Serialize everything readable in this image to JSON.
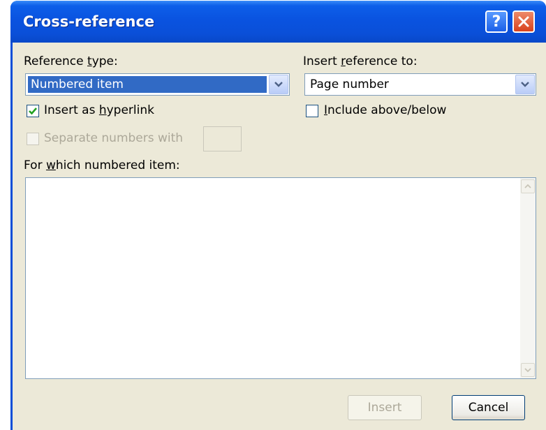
{
  "window": {
    "title": "Cross-reference",
    "help_glyph": "?"
  },
  "reference_type": {
    "label_pre": "Reference ",
    "label_access": "t",
    "label_post": "ype:",
    "value": "Numbered item"
  },
  "insert_reference_to": {
    "label_pre": "Insert ",
    "label_access": "r",
    "label_post": "eference to:",
    "value": "Page number"
  },
  "insert_as_hyperlink": {
    "label_pre": "Insert as ",
    "label_access": "h",
    "label_post": "yperlink",
    "checked": true
  },
  "include_above_below": {
    "label_pre": "",
    "label_access": "I",
    "label_post": "nclude above/below",
    "checked": false
  },
  "separate_numbers": {
    "label": "Separate numbers with",
    "checked": false,
    "enabled": false,
    "value": ""
  },
  "for_which": {
    "label_pre": "For ",
    "label_access": "w",
    "label_post": "hich numbered item:",
    "items": []
  },
  "buttons": {
    "insert": "Insert",
    "cancel": "Cancel"
  },
  "colors": {
    "titlebar": "#0a4fd8",
    "dialog_bg": "#ece9d8",
    "selection": "#316ac5",
    "close_button": "#d8421c"
  },
  "icons": {
    "help": "help-icon",
    "close": "close-icon",
    "dropdown": "chevron-down-icon",
    "check": "check-icon",
    "scroll_up": "scroll-up-icon",
    "scroll_down": "scroll-down-icon"
  }
}
